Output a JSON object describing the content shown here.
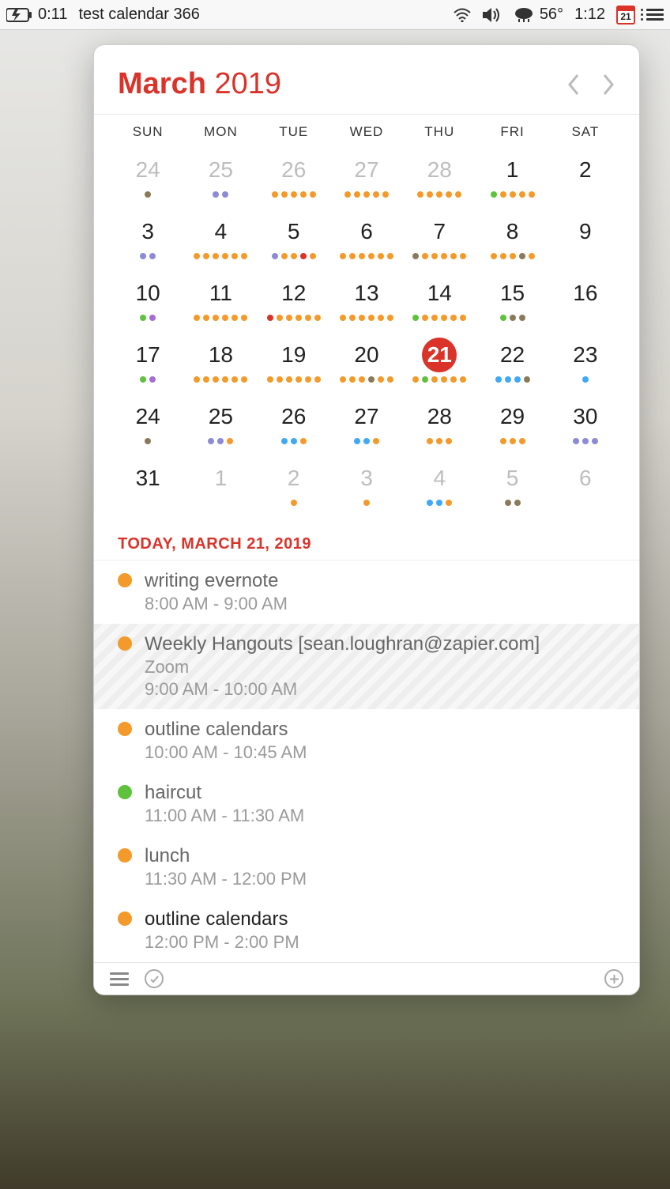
{
  "menubar": {
    "battery_time": "0:11",
    "app_title": "test calendar 366",
    "temp": "56°",
    "clock": "1:12",
    "cal_badge": "21"
  },
  "calendar": {
    "month": "March",
    "year": "2019",
    "dow": [
      "SUN",
      "MON",
      "TUE",
      "WED",
      "THU",
      "FRI",
      "SAT"
    ],
    "weeks": [
      [
        {
          "n": "24",
          "other": true,
          "dots": [
            "#8a7a5a"
          ]
        },
        {
          "n": "25",
          "other": true,
          "dots": [
            "#8d8ad6",
            "#8d8ad6"
          ]
        },
        {
          "n": "26",
          "other": true,
          "dots": [
            "#f39a2b",
            "#f39a2b",
            "#f39a2b",
            "#f39a2b",
            "#f39a2b"
          ]
        },
        {
          "n": "27",
          "other": true,
          "dots": [
            "#f39a2b",
            "#f39a2b",
            "#f39a2b",
            "#f39a2b",
            "#f39a2b"
          ]
        },
        {
          "n": "28",
          "other": true,
          "dots": [
            "#f39a2b",
            "#f39a2b",
            "#f39a2b",
            "#f39a2b",
            "#f39a2b"
          ]
        },
        {
          "n": "1",
          "dots": [
            "#5ec23d",
            "#f39a2b",
            "#f39a2b",
            "#f39a2b",
            "#f39a2b"
          ]
        },
        {
          "n": "2",
          "dots": []
        }
      ],
      [
        {
          "n": "3",
          "dots": [
            "#8d8ad6",
            "#8d8ad6"
          ]
        },
        {
          "n": "4",
          "dots": [
            "#f39a2b",
            "#f39a2b",
            "#f39a2b",
            "#f39a2b",
            "#f39a2b",
            "#f39a2b"
          ]
        },
        {
          "n": "5",
          "dots": [
            "#8d8ad6",
            "#f39a2b",
            "#f39a2b",
            "#d9332a",
            "#f39a2b"
          ]
        },
        {
          "n": "6",
          "dots": [
            "#f39a2b",
            "#f39a2b",
            "#f39a2b",
            "#f39a2b",
            "#f39a2b",
            "#f39a2b"
          ]
        },
        {
          "n": "7",
          "dots": [
            "#8a7a5a",
            "#f39a2b",
            "#f39a2b",
            "#f39a2b",
            "#f39a2b",
            "#f39a2b"
          ]
        },
        {
          "n": "8",
          "dots": [
            "#f39a2b",
            "#f39a2b",
            "#f39a2b",
            "#8a7a5a",
            "#f39a2b"
          ]
        },
        {
          "n": "9",
          "dots": []
        }
      ],
      [
        {
          "n": "10",
          "dots": [
            "#5ec23d",
            "#a36ed6"
          ]
        },
        {
          "n": "11",
          "dots": [
            "#f39a2b",
            "#f39a2b",
            "#f39a2b",
            "#f39a2b",
            "#f39a2b",
            "#f39a2b"
          ]
        },
        {
          "n": "12",
          "dots": [
            "#d9332a",
            "#f39a2b",
            "#f39a2b",
            "#f39a2b",
            "#f39a2b",
            "#f39a2b"
          ]
        },
        {
          "n": "13",
          "dots": [
            "#f39a2b",
            "#f39a2b",
            "#f39a2b",
            "#f39a2b",
            "#f39a2b",
            "#f39a2b"
          ]
        },
        {
          "n": "14",
          "dots": [
            "#5ec23d",
            "#f39a2b",
            "#f39a2b",
            "#f39a2b",
            "#f39a2b",
            "#f39a2b"
          ]
        },
        {
          "n": "15",
          "dots": [
            "#5ec23d",
            "#8a7a5a",
            "#8a7a5a"
          ]
        },
        {
          "n": "16",
          "dots": []
        }
      ],
      [
        {
          "n": "17",
          "dots": [
            "#5ec23d",
            "#a36ed6"
          ]
        },
        {
          "n": "18",
          "dots": [
            "#f39a2b",
            "#f39a2b",
            "#f39a2b",
            "#f39a2b",
            "#f39a2b",
            "#f39a2b"
          ]
        },
        {
          "n": "19",
          "dots": [
            "#f39a2b",
            "#f39a2b",
            "#f39a2b",
            "#f39a2b",
            "#f39a2b",
            "#f39a2b"
          ]
        },
        {
          "n": "20",
          "dots": [
            "#f39a2b",
            "#f39a2b",
            "#f39a2b",
            "#8a7a5a",
            "#f39a2b",
            "#f39a2b"
          ]
        },
        {
          "n": "21",
          "today": true,
          "dots": [
            "#f39a2b",
            "#5ec23d",
            "#f39a2b",
            "#f39a2b",
            "#f39a2b",
            "#f39a2b"
          ]
        },
        {
          "n": "22",
          "dots": [
            "#3fa9f5",
            "#3fa9f5",
            "#3fa9f5",
            "#8a7a5a"
          ]
        },
        {
          "n": "23",
          "dots": [
            "#3fa9f5"
          ]
        }
      ],
      [
        {
          "n": "24",
          "dots": [
            "#8a7a5a"
          ]
        },
        {
          "n": "25",
          "dots": [
            "#8d8ad6",
            "#8d8ad6",
            "#f39a2b"
          ]
        },
        {
          "n": "26",
          "dots": [
            "#3fa9f5",
            "#3fa9f5",
            "#f39a2b"
          ]
        },
        {
          "n": "27",
          "dots": [
            "#3fa9f5",
            "#3fa9f5",
            "#f39a2b"
          ]
        },
        {
          "n": "28",
          "dots": [
            "#f39a2b",
            "#f39a2b",
            "#f39a2b"
          ]
        },
        {
          "n": "29",
          "dots": [
            "#f39a2b",
            "#f39a2b",
            "#f39a2b"
          ]
        },
        {
          "n": "30",
          "dots": [
            "#8d8ad6",
            "#8d8ad6",
            "#8d8ad6"
          ]
        }
      ],
      [
        {
          "n": "31",
          "dots": []
        },
        {
          "n": "1",
          "other": true,
          "dots": []
        },
        {
          "n": "2",
          "other": true,
          "dots": [
            "#f39a2b"
          ]
        },
        {
          "n": "3",
          "other": true,
          "dots": [
            "#f39a2b"
          ]
        },
        {
          "n": "4",
          "other": true,
          "dots": [
            "#3fa9f5",
            "#3fa9f5",
            "#f39a2b"
          ]
        },
        {
          "n": "5",
          "other": true,
          "dots": [
            "#8a7a5a",
            "#8a7a5a"
          ]
        },
        {
          "n": "6",
          "other": true,
          "dots": []
        }
      ]
    ]
  },
  "today_label": "TODAY, MARCH 21, 2019",
  "events": [
    {
      "color": "#f39a2b",
      "title": "writing evernote",
      "time": "8:00 AM - 9:00 AM"
    },
    {
      "color": "#f39a2b",
      "title": "Weekly Hangouts [sean.loughran@zapier.com]",
      "sub": "Zoom",
      "time": "9:00 AM - 10:00 AM",
      "striped": true
    },
    {
      "color": "#f39a2b",
      "title": "outline calendars",
      "time": "10:00 AM - 10:45 AM"
    },
    {
      "color": "#5ec23d",
      "title": "haircut",
      "time": "11:00 AM - 11:30 AM"
    },
    {
      "color": "#f39a2b",
      "title": "lunch",
      "time": "11:30 AM - 12:00 PM"
    },
    {
      "color": "#f39a2b",
      "title": "outline calendars",
      "time": "12:00 PM - 2:00 PM",
      "current": true
    }
  ]
}
